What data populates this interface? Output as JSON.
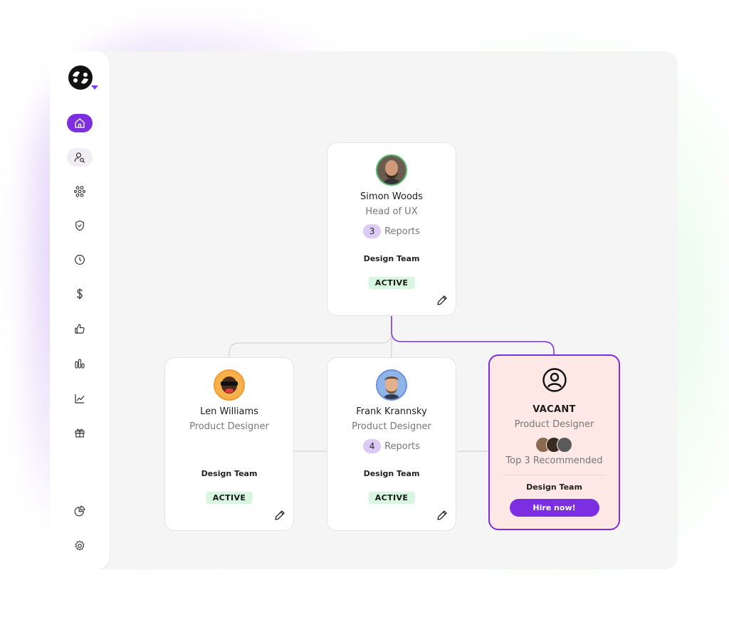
{
  "colors": {
    "accent": "#7b2fe0",
    "active_badge_bg": "#d7f6df",
    "vacant_bg": "#fde8e5",
    "reports_badge_bg": "#dcc9f4"
  },
  "sidebar": {
    "logo_icon": "brand-logo-icon",
    "items": [
      {
        "icon": "home-icon",
        "state": "active"
      },
      {
        "icon": "user-search-icon",
        "state": "hover"
      },
      {
        "icon": "org-chart-icon"
      },
      {
        "icon": "shield-check-icon"
      },
      {
        "icon": "clock-icon"
      },
      {
        "icon": "dollar-icon"
      },
      {
        "icon": "thumbs-up-icon"
      },
      {
        "icon": "bar-chart-icon"
      },
      {
        "icon": "line-chart-icon"
      },
      {
        "icon": "gift-icon"
      },
      {
        "icon": "pie-chart-icon"
      },
      {
        "icon": "settings-icon"
      }
    ]
  },
  "org": {
    "manager": {
      "name": "Simon Woods",
      "role": "Head of UX",
      "reports_count": "3",
      "reports_label": "Reports",
      "team": "Design Team",
      "status": "ACTIVE"
    },
    "members": [
      {
        "name": "Len Williams",
        "role": "Product Designer",
        "team": "Design Team",
        "status": "ACTIVE"
      },
      {
        "name": "Frank Krannsky",
        "role": "Product Designer",
        "reports_count": "4",
        "reports_label": "Reports",
        "team": "Design Team",
        "status": "ACTIVE"
      }
    ],
    "vacant": {
      "title": "VACANT",
      "role": "Product Designer",
      "recommended_label": "Top 3 Recommended",
      "team": "Design Team",
      "hire_button": "Hire now!"
    }
  }
}
